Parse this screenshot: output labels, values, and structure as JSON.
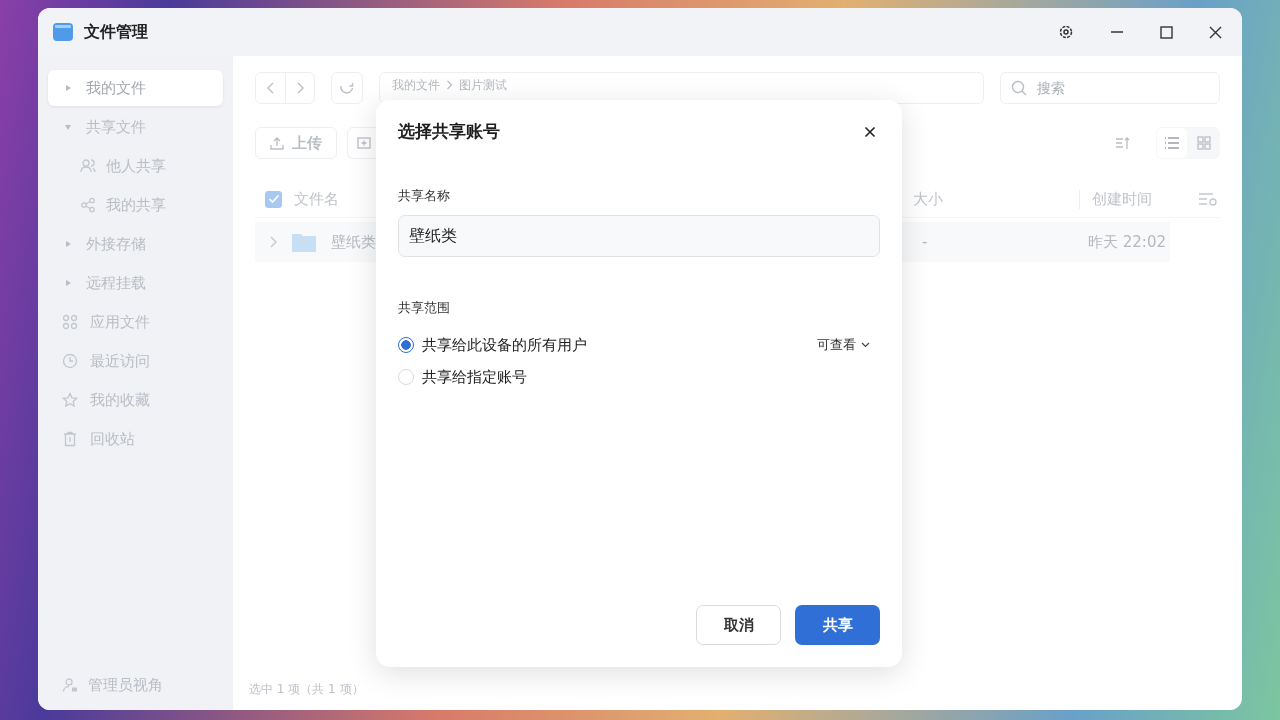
{
  "window": {
    "title": "文件管理"
  },
  "sidebar": {
    "items": [
      {
        "kind": "group",
        "label": "我的文件",
        "selected": true,
        "expanded": false
      },
      {
        "kind": "group",
        "label": "共享文件",
        "selected": false,
        "expanded": true,
        "children": [
          {
            "label": "他人共享",
            "selected": false
          },
          {
            "label": "我的共享",
            "selected": false
          }
        ]
      },
      {
        "kind": "group",
        "label": "外接存储",
        "selected": false,
        "expanded": false
      },
      {
        "kind": "group",
        "label": "远程挂载",
        "selected": false,
        "expanded": false
      },
      {
        "kind": "link",
        "label": "应用文件",
        "selected": false
      },
      {
        "kind": "link",
        "label": "最近访问",
        "selected": false
      },
      {
        "kind": "link",
        "label": "我的收藏",
        "selected": false
      },
      {
        "kind": "link",
        "label": "回收站",
        "selected": false
      }
    ],
    "footer": "管理员视角"
  },
  "breadcrumb": [
    "我的文件",
    "图片测试"
  ],
  "search": {
    "placeholder": "搜索"
  },
  "toolbar": {
    "upload": "上传"
  },
  "table": {
    "columns": [
      "文件名",
      "大小",
      "创建时间"
    ],
    "select_all_checked": true,
    "rows": [
      {
        "name": "壁纸类",
        "size": "-",
        "created": "昨天 22:02"
      }
    ]
  },
  "status_bar": "选中 1 项（共 1 项）",
  "dialog": {
    "title": "选择共享账号",
    "name_label": "共享名称",
    "name_value": "壁纸类",
    "scope_label": "共享范围",
    "options": [
      {
        "label": "共享给此设备的所有用户",
        "selected": true,
        "permission": "可查看"
      },
      {
        "label": "共享给指定账号",
        "selected": false
      }
    ],
    "buttons": [
      {
        "kind": "secondary",
        "label": "取消"
      },
      {
        "kind": "primary",
        "label": "共享"
      }
    ]
  }
}
